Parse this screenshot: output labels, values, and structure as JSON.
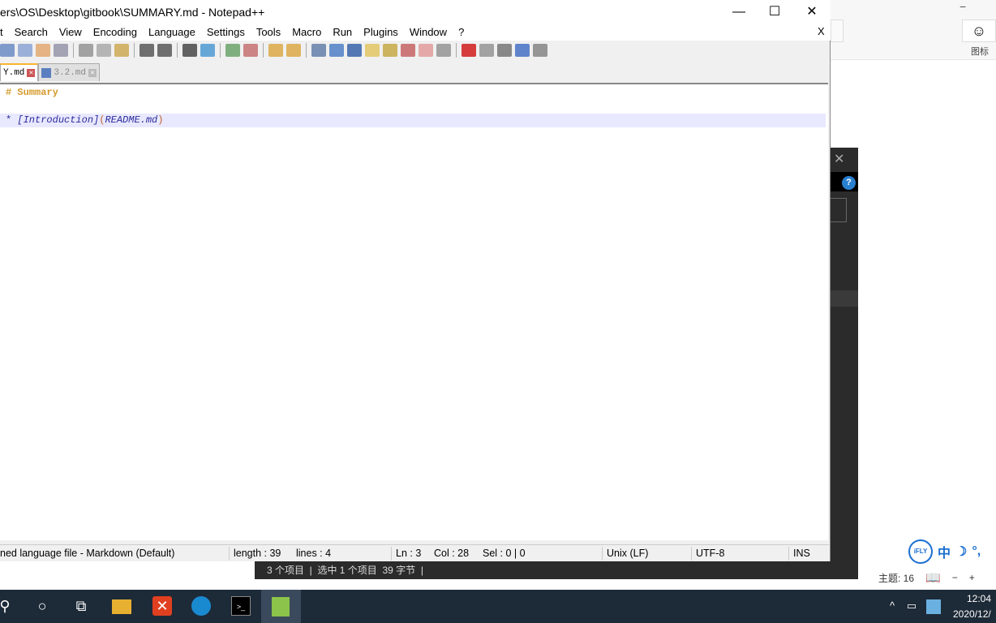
{
  "window": {
    "title": "ers\\OS\\Desktop\\gitbook\\SUMMARY.md - Notepad++",
    "minimize": "—",
    "maximize": "☐",
    "close": "✕"
  },
  "menu": {
    "items": [
      "t",
      "Search",
      "View",
      "Encoding",
      "Language",
      "Settings",
      "Tools",
      "Macro",
      "Run",
      "Plugins",
      "Window",
      "?"
    ],
    "close": "X"
  },
  "toolbar": {
    "icons": [
      {
        "name": "save-all-icon",
        "color": "#5a7fc0"
      },
      {
        "name": "close-icon",
        "color": "#7f9bd0"
      },
      {
        "name": "close-all-icon",
        "color": "#e0a060"
      },
      {
        "name": "print-icon",
        "color": "#8a8aa0"
      },
      "sep",
      {
        "name": "cut-icon",
        "color": "#888"
      },
      {
        "name": "copy-icon",
        "color": "#a0a0a0"
      },
      {
        "name": "paste-icon",
        "color": "#c8a040"
      },
      "sep",
      {
        "name": "undo-icon",
        "color": "#444"
      },
      {
        "name": "redo-icon",
        "color": "#444"
      },
      "sep",
      {
        "name": "find-icon",
        "color": "#333"
      },
      {
        "name": "replace-icon",
        "color": "#3a8fd0"
      },
      "sep",
      {
        "name": "zoom-in-icon",
        "color": "#5a9a5a"
      },
      {
        "name": "zoom-out-icon",
        "color": "#c06060"
      },
      "sep",
      {
        "name": "sync-vertical-icon",
        "color": "#d8a030"
      },
      {
        "name": "sync-horizontal-icon",
        "color": "#d8a030"
      },
      "sep",
      {
        "name": "word-wrap-icon",
        "color": "#5070a0"
      },
      {
        "name": "show-all-characters-icon",
        "color": "#3a70c0"
      },
      {
        "name": "indent-guide-icon",
        "color": "#2050a0"
      },
      {
        "name": "user-language-icon",
        "color": "#e0c050"
      },
      {
        "name": "document-map-icon",
        "color": "#c0a030"
      },
      {
        "name": "function-list-icon",
        "color": "#c05050"
      },
      {
        "name": "folder-workspace-icon",
        "color": "#e09090"
      },
      {
        "name": "monitoring-icon",
        "color": "#888"
      },
      "sep",
      {
        "name": "record-macro-icon",
        "color": "#c00"
      },
      {
        "name": "stop-recording-icon",
        "color": "#888"
      },
      {
        "name": "play-macro-icon",
        "color": "#666"
      },
      {
        "name": "run-macro-multiple-icon",
        "color": "#3060c0"
      },
      {
        "name": "save-macro-icon",
        "color": "#777"
      }
    ]
  },
  "tabs": [
    {
      "label": "Y.md",
      "active": true
    },
    {
      "label": "3.2.md",
      "active": false
    }
  ],
  "editor": {
    "lines": [
      {
        "segments": [
          {
            "text": "# Summary",
            "color": "#d59a2c",
            "bold": true
          }
        ]
      },
      {
        "segments": []
      },
      {
        "segments": [
          {
            "text": "* ",
            "color": "#2a2a9a"
          },
          {
            "text": "[Introduction]",
            "color": "#2a2a9a",
            "italic": true
          },
          {
            "text": "(",
            "color": "#c0602a"
          },
          {
            "text": "README.md",
            "color": "#2a2a9a",
            "italic": true
          },
          {
            "text": ")",
            "color": "#c0602a"
          }
        ]
      }
    ]
  },
  "status": {
    "language": "ned language file - Markdown (Default)",
    "length": "length : 39",
    "lines": "lines : 4",
    "ln": "Ln : 3",
    "col": "Col : 28",
    "sel": "Sel : 0 | 0",
    "eol": "Unix (LF)",
    "encoding": "UTF-8",
    "mode": "INS"
  },
  "explorer": {
    "status": "3 个项目  |  选中 1 个项目  39 字节  |"
  },
  "background_app": {
    "icon_label": "图标",
    "theme": "主题: 16",
    "minus": "−",
    "plus": "+"
  },
  "ime": {
    "logo": "iFLY",
    "chinese": "中",
    "moon": "☽",
    "punct": "°,"
  },
  "taskbar": {
    "time": "12:04",
    "date": "2020/12/",
    "colors": {
      "bg": "#1d2a38"
    }
  }
}
